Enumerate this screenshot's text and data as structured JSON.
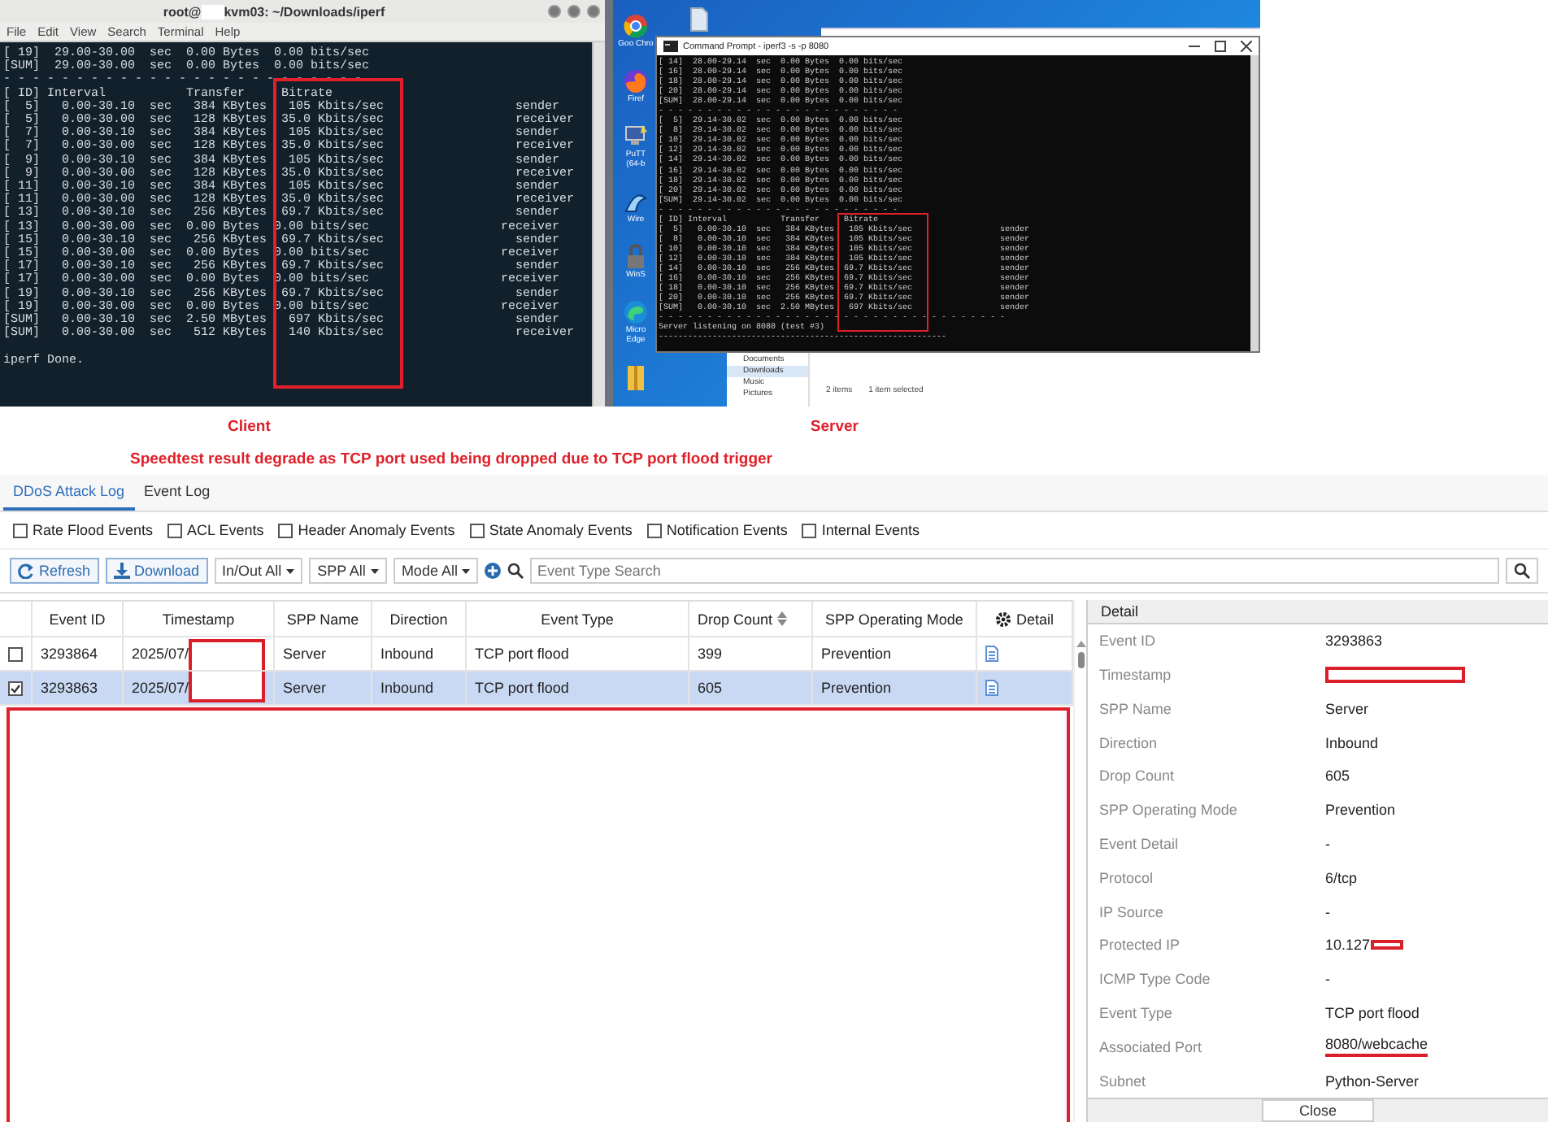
{
  "client_terminal": {
    "title_before": "root@",
    "title_after": "kvm03: ~/Downloads/iperf",
    "menu": [
      "File",
      "Edit",
      "View",
      "Search",
      "Terminal",
      "Help"
    ],
    "lines": [
      "[ 19]  29.00-30.00  sec  0.00 Bytes  0.00 bits/sec",
      "[SUM]  29.00-30.00  sec  0.00 Bytes  0.00 bits/sec",
      "- - - - - - - - - - - - - - - - - - - - - - - - -",
      "[ ID] Interval           Transfer     Bitrate",
      "[  5]   0.00-30.10  sec   384 KBytes   105 Kbits/sec                  sender",
      "[  5]   0.00-30.00  sec   128 KBytes  35.0 Kbits/sec                  receiver",
      "[  7]   0.00-30.10  sec   384 KBytes   105 Kbits/sec                  sender",
      "[  7]   0.00-30.00  sec   128 KBytes  35.0 Kbits/sec                  receiver",
      "[  9]   0.00-30.10  sec   384 KBytes   105 Kbits/sec                  sender",
      "[  9]   0.00-30.00  sec   128 KBytes  35.0 Kbits/sec                  receiver",
      "[ 11]   0.00-30.10  sec   384 KBytes   105 Kbits/sec                  sender",
      "[ 11]   0.00-30.00  sec   128 KBytes  35.0 Kbits/sec                  receiver",
      "[ 13]   0.00-30.10  sec   256 KBytes  69.7 Kbits/sec                  sender",
      "[ 13]   0.00-30.00  sec  0.00 Bytes  0.00 bits/sec                  receiver",
      "[ 15]   0.00-30.10  sec   256 KBytes  69.7 Kbits/sec                  sender",
      "[ 15]   0.00-30.00  sec  0.00 Bytes  0.00 bits/sec                  receiver",
      "[ 17]   0.00-30.10  sec   256 KBytes  69.7 Kbits/sec                  sender",
      "[ 17]   0.00-30.00  sec  0.00 Bytes  0.00 bits/sec                  receiver",
      "[ 19]   0.00-30.10  sec   256 KBytes  69.7 Kbits/sec                  sender",
      "[ 19]   0.00-30.00  sec  0.00 Bytes  0.00 bits/sec                  receiver",
      "[SUM]   0.00-30.10  sec  2.50 MBytes   697 Kbits/sec                  sender",
      "[SUM]   0.00-30.00  sec   512 KBytes   140 Kbits/sec                  receiver",
      "iperf Done."
    ]
  },
  "server_desktop": {
    "desktop_icons": [
      {
        "kind": "ring",
        "label": "Goo Chro"
      },
      {
        "kind": "flame",
        "label": "Firef"
      },
      {
        "kind": "monitor",
        "label": "PuTT (64-b"
      },
      {
        "kind": "fin",
        "label": "Wire"
      },
      {
        "kind": "lock",
        "label": "WinS"
      },
      {
        "kind": "swirl",
        "label": "Micro Edge"
      },
      {
        "kind": "folder"
      }
    ],
    "cmd_window": {
      "title": "Command Prompt - iperf3  -s -p 8080",
      "lines": [
        "[ 14]  28.00-29.14  sec  0.00 Bytes  0.00 bits/sec",
        "[ 16]  28.00-29.14  sec  0.00 Bytes  0.00 bits/sec",
        "[ 18]  28.00-29.14  sec  0.00 Bytes  0.00 bits/sec",
        "[ 20]  28.00-29.14  sec  0.00 Bytes  0.00 bits/sec",
        "[SUM]  28.00-29.14  sec  0.00 Bytes  0.00 bits/sec",
        "- - - - - - - - - - - - - - - - - - - - - - - - -",
        "[  5]  29.14-30.02  sec  0.00 Bytes  0.00 bits/sec",
        "[  8]  29.14-30.02  sec  0.00 Bytes  0.00 bits/sec",
        "[ 10]  29.14-30.02  sec  0.00 Bytes  0.00 bits/sec",
        "[ 12]  29.14-30.02  sec  0.00 Bytes  0.00 bits/sec",
        "[ 14]  29.14-30.02  sec  0.00 Bytes  0.00 bits/sec",
        "[ 16]  29.14-30.02  sec  0.00 Bytes  0.00 bits/sec",
        "[ 18]  29.14-30.02  sec  0.00 Bytes  0.00 bits/sec",
        "[ 20]  29.14-30.02  sec  0.00 Bytes  0.00 bits/sec",
        "[SUM]  29.14-30.02  sec  0.00 Bytes  0.00 bits/sec",
        "- - - - - - - - - - - - - - - - - - - - - - - - -",
        "[ ID] Interval           Transfer     Bitrate",
        "[  5]   0.00-30.10  sec   384 KBytes   105 Kbits/sec                  sender",
        "[  8]   0.00-30.10  sec   384 KBytes   105 Kbits/sec                  sender",
        "[ 10]   0.00-30.10  sec   384 KBytes   105 Kbits/sec                  sender",
        "[ 12]   0.00-30.10  sec   384 KBytes   105 Kbits/sec                  sender",
        "[ 14]   0.00-30.10  sec   256 KBytes  69.7 Kbits/sec                  sender",
        "[ 16]   0.00-30.10  sec   256 KBytes  69.7 Kbits/sec                  sender",
        "[ 18]   0.00-30.10  sec   256 KBytes  69.7 Kbits/sec                  sender",
        "[ 20]   0.00-30.10  sec   256 KBytes  69.7 Kbits/sec                  sender",
        "[SUM]   0.00-30.10  sec  2.50 MBytes   697 Kbits/sec                  sender",
        "- - - - - - - - - - - - - - - - - - - - - - - - - - - - - - - - - - - -",
        "Server listening on 8080 (test #3)",
        "-----------------------------------------------------------"
      ]
    },
    "explorer": {
      "nav_items": [
        {
          "label": "Documents",
          "selected": false
        },
        {
          "label": "Downloads",
          "selected": true
        },
        {
          "label": "Music",
          "selected": false
        },
        {
          "label": "Pictures",
          "selected": false
        }
      ],
      "status": [
        "2 items",
        "1 item selected"
      ]
    }
  },
  "captions": {
    "client": "Client",
    "server": "Server",
    "note": "Speedtest result degrade as TCP port used being dropped due to TCP port flood trigger"
  },
  "tabs": [
    {
      "label": "DDoS Attack Log",
      "selected": true
    },
    {
      "label": "Event Log",
      "selected": false
    }
  ],
  "filters": [
    {
      "label": "Rate Flood Events",
      "checked": false
    },
    {
      "label": "ACL Events",
      "checked": false
    },
    {
      "label": "Header Anomaly Events",
      "checked": false
    },
    {
      "label": "State Anomaly Events",
      "checked": false
    },
    {
      "label": "Notification Events",
      "checked": false
    },
    {
      "label": "Internal Events",
      "checked": false
    }
  ],
  "toolbar": {
    "buttons": [
      {
        "kind": "refresh",
        "label": "Refresh"
      },
      {
        "kind": "download",
        "label": "Download"
      }
    ],
    "dropdowns": [
      "In/Out All",
      "SPP All",
      "Mode All"
    ],
    "search": {
      "placeholder": "Event Type Search"
    }
  },
  "table": {
    "columns": [
      {
        "label": "Event ID"
      },
      {
        "label": "Timestamp"
      },
      {
        "label": "SPP Name"
      },
      {
        "label": "Direction"
      },
      {
        "label": "Event Type"
      },
      {
        "label": "Drop Count",
        "sortable": true
      },
      {
        "label": "SPP Operating Mode"
      },
      {
        "label": "Detail",
        "kind": "settings"
      }
    ],
    "rows": [
      {
        "checked": false,
        "selected": false,
        "timestamp_redacted": true,
        "cells": [
          "3293864",
          "2025/07/",
          "Server",
          "Inbound",
          "TCP port flood",
          "399",
          "Prevention"
        ]
      },
      {
        "checked": true,
        "selected": true,
        "timestamp_redacted": true,
        "cells": [
          "3293863",
          "2025/07/",
          "Server",
          "Inbound",
          "TCP port flood",
          "605",
          "Prevention"
        ]
      }
    ]
  },
  "detail": {
    "title": "Detail",
    "fields": [
      {
        "label": "Event ID",
        "value": "3293863"
      },
      {
        "label": "Timestamp",
        "redacted": true
      },
      {
        "label": "SPP Name",
        "value": "Server"
      },
      {
        "label": "Direction",
        "value": "Inbound"
      },
      {
        "label": "Drop Count",
        "value": "605"
      },
      {
        "label": "SPP Operating Mode",
        "value": "Prevention"
      },
      {
        "label": "Event Detail",
        "value": "-"
      },
      {
        "label": "Protocol",
        "value": "6/tcp"
      },
      {
        "label": "IP Source",
        "value": "-"
      },
      {
        "label": "Protected IP",
        "value": "10.127",
        "redacted": true
      },
      {
        "label": "ICMP Type Code",
        "value": "-"
      },
      {
        "label": "Event Type",
        "value": "TCP port flood"
      },
      {
        "label": "Associated Port",
        "value": "8080/webcache",
        "underlined": true
      },
      {
        "label": "Subnet",
        "value": "Python-Server"
      }
    ],
    "close": "Close"
  }
}
